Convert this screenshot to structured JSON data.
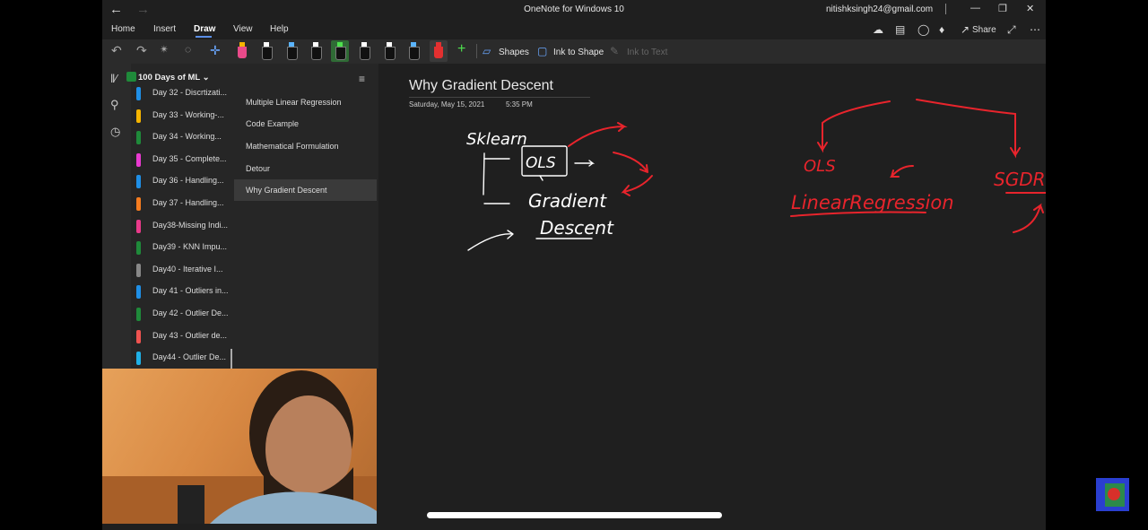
{
  "window": {
    "title": "OneNote for Windows 10",
    "user_email": "nitishksingh24@gmail.com",
    "back_icon": "arrow-left-icon",
    "forward_icon": "arrow-right-icon",
    "controls": [
      "minimize-icon",
      "restore-icon",
      "close-icon"
    ]
  },
  "ribbon": {
    "tabs": [
      {
        "label": "Home"
      },
      {
        "label": "Insert"
      },
      {
        "label": "Draw",
        "active": true
      },
      {
        "label": "View"
      },
      {
        "label": "Help"
      }
    ],
    "right_icons": [
      "sync-icon",
      "notebook-icon",
      "lightbulb-icon",
      "bell-icon",
      "share-icon",
      "expand-icon",
      "more-icon"
    ],
    "share_label": "Share",
    "tools": [
      "undo-icon",
      "redo-icon",
      "lasso-icon",
      "eraser-icon",
      "ruler-icon"
    ],
    "pens": [
      {
        "color": "#e94a8a",
        "kind": "highlighter"
      },
      {
        "color": "#ffffff"
      },
      {
        "color": "#5ab4ff"
      },
      {
        "color": "#ffffff"
      },
      {
        "color": "#4ee04e",
        "selected": true
      },
      {
        "color": "#ffffff"
      },
      {
        "color": "#ffffff"
      },
      {
        "color": "#5ab4ff"
      },
      {
        "color": "#e33030",
        "selected": true
      }
    ],
    "add_pen_icon": "plus-icon",
    "shapes_label": "Shapes",
    "ink_to_shape_label": "Ink to Shape",
    "ink_to_text_label": "Ink to Text"
  },
  "rail": {
    "icons": [
      "notebooks-icon",
      "search-icon",
      "recent-icon"
    ]
  },
  "notebook": {
    "name": "100 Days of ML",
    "sections": [
      {
        "label": "Day 32 - Discrtizati...",
        "color": "#1f8fe6"
      },
      {
        "label": "Day 33 - Working-...",
        "color": "#f5b400"
      },
      {
        "label": "Day 34 - Working...",
        "color": "#1f8a3a"
      },
      {
        "label": "Day 35 - Complete...",
        "color": "#e93ad0"
      },
      {
        "label": "Day 36 - Handling...",
        "color": "#1f8fe6"
      },
      {
        "label": "Day 37 - Handling...",
        "color": "#f57c1f"
      },
      {
        "label": "Day38-Missing Indi...",
        "color": "#e93a8a"
      },
      {
        "label": "Day39 - KNN Impu...",
        "color": "#1f8a3a"
      },
      {
        "label": "Day40 - Iterative I...",
        "color": "#888888"
      },
      {
        "label": "Day 41 - Outliers in...",
        "color": "#1f8fe6"
      },
      {
        "label": "Day 42 - Outlier De...",
        "color": "#1f8a3a"
      },
      {
        "label": "Day 43 - Outlier de...",
        "color": "#ef5350"
      },
      {
        "label": "Day44 - Outlier De...",
        "color": "#1fb0e6"
      }
    ]
  },
  "pages": {
    "items": [
      {
        "label": "Multiple Linear Regression"
      },
      {
        "label": "Code Example"
      },
      {
        "label": "Mathematical Formulation"
      },
      {
        "label": "Detour"
      },
      {
        "label": "Why Gradient Descent",
        "selected": true
      }
    ]
  },
  "canvas": {
    "title": "Why Gradient Descent",
    "date": "Saturday, May 15, 2021",
    "time": "5:35 PM",
    "ink_white": {
      "sklearn": "Sklearn",
      "ols": "OLS",
      "gradient": "Gradient",
      "descent": "Descent"
    },
    "ink_red": {
      "ols": "OLS",
      "linear_regression": "LinearRegression",
      "sgd_regressor": "SGDRegressor"
    },
    "ink_white_color": "#ffffff",
    "ink_red_color": "#e8242c"
  }
}
